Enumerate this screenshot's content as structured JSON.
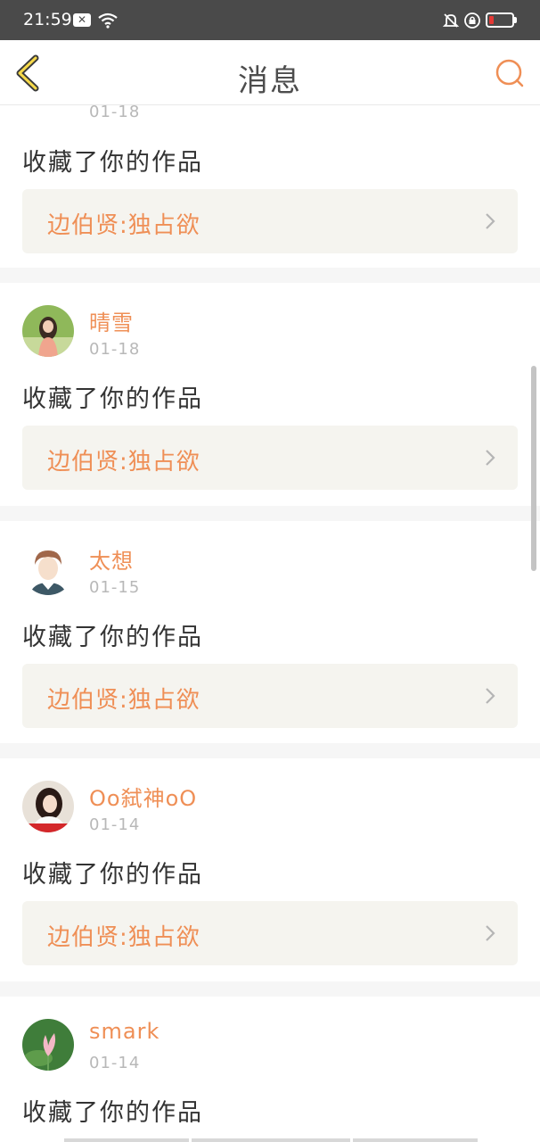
{
  "status_bar": {
    "time": "21:59",
    "notification_icon": "close-badge-icon",
    "battery_level": 0.1
  },
  "header": {
    "title": "消息",
    "back_icon": "chevron-left-icon",
    "search_icon": "search-icon"
  },
  "messages": [
    {
      "user": "",
      "date": "01-18",
      "action": "收藏了你的作品",
      "work": "边伯贤:独占欲"
    },
    {
      "user": "晴雪",
      "date": "01-18",
      "action": "收藏了你的作品",
      "work": "边伯贤:独占欲"
    },
    {
      "user": "太想",
      "date": "01-15",
      "action": "收藏了你的作品",
      "work": "边伯贤:独占欲"
    },
    {
      "user": "Oo弑神oO",
      "date": "01-14",
      "action": "收藏了你的作品",
      "work": "边伯贤:独占欲"
    },
    {
      "user": "smark",
      "date": "01-14",
      "action": "收藏了你的作品",
      "work": ""
    }
  ],
  "colors": {
    "accent": "#ef8f56",
    "status_bar": "#4a4a4a",
    "work_bg": "#f5f4ef",
    "separator": "#f6f6f6"
  }
}
